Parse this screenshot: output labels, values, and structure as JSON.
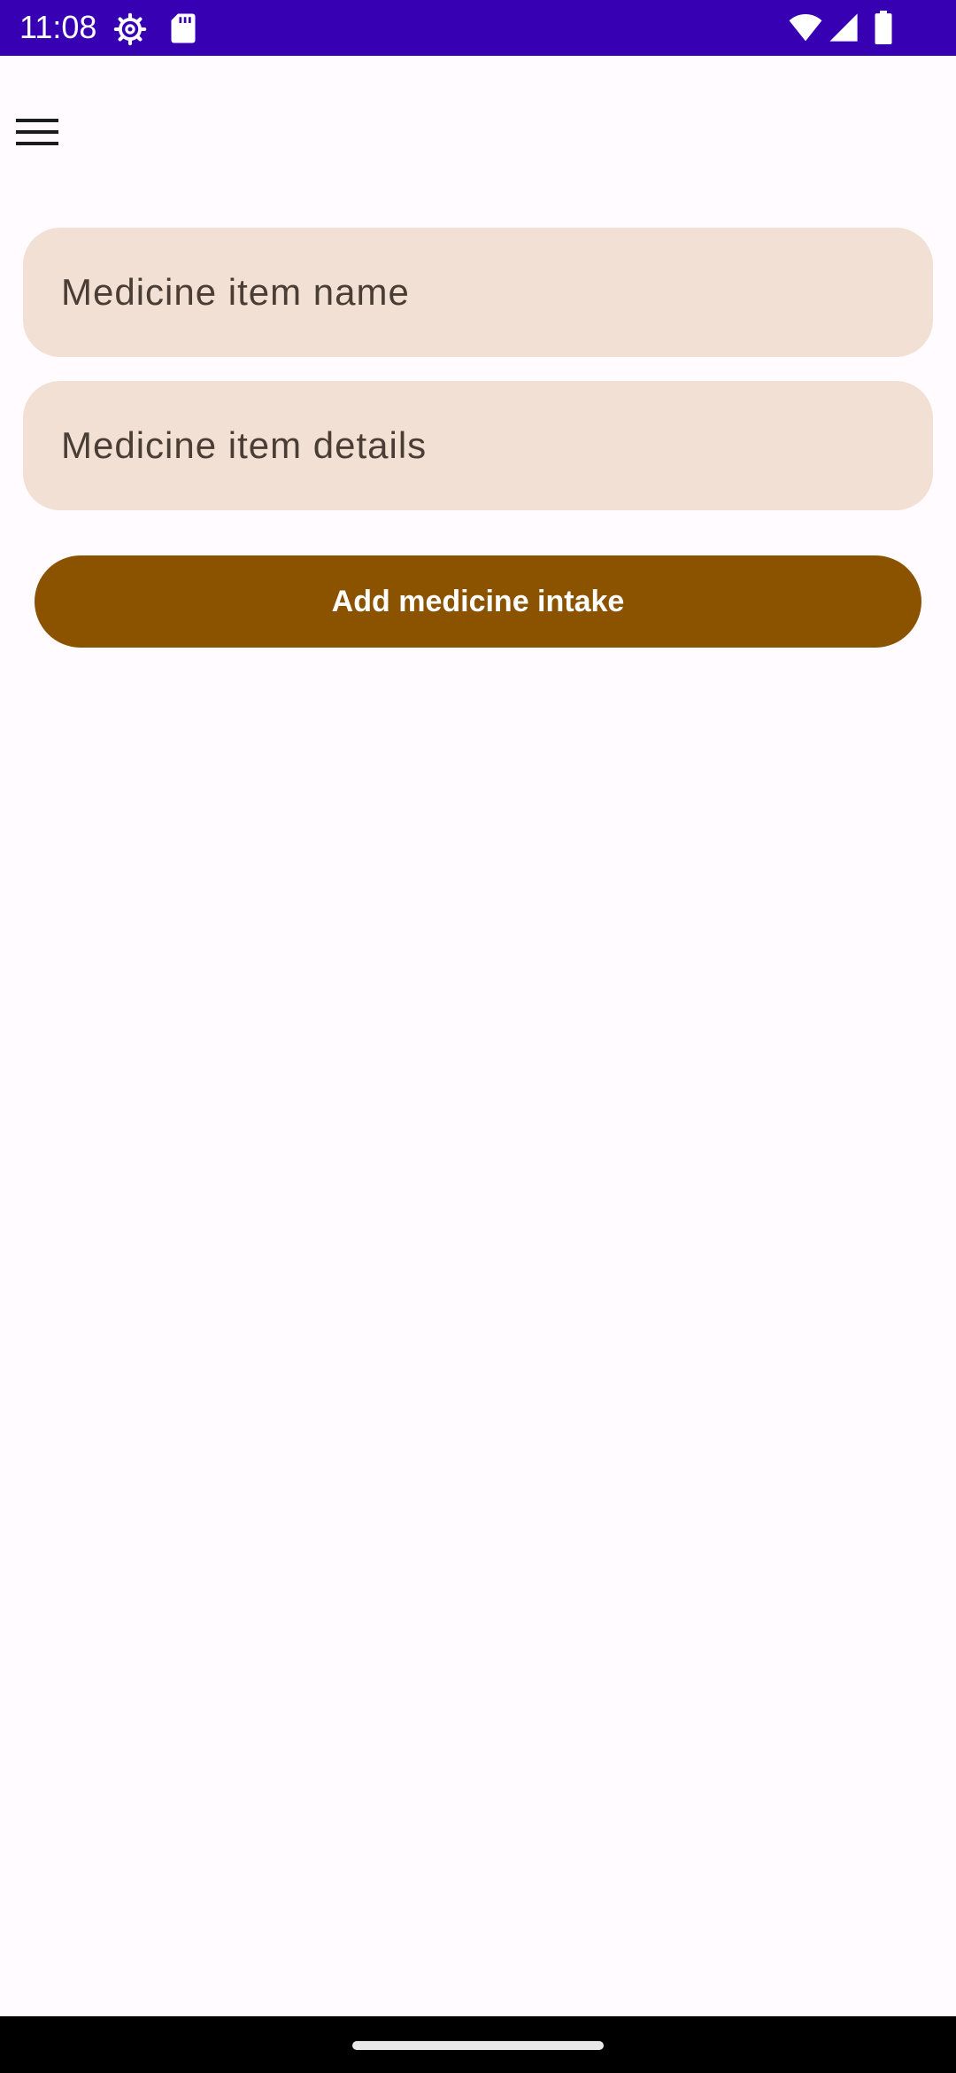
{
  "status_bar": {
    "time": "11:08",
    "icons": [
      "settings-gear-icon",
      "sd-card-icon",
      "wifi-icon",
      "cell-signal-icon",
      "battery-icon"
    ],
    "background_color": "#3700b3"
  },
  "app_bar": {
    "menu_icon": "hamburger-menu-icon"
  },
  "form": {
    "name_placeholder": "Medicine item name",
    "details_placeholder": "Medicine item details",
    "name_value": "",
    "details_value": "",
    "field_color": "#f1e0d3",
    "add_button_label": "Add medicine intake",
    "add_button_color": "#8b5300"
  },
  "nav_bar": {
    "home_indicator": "gesture-home-indicator"
  }
}
